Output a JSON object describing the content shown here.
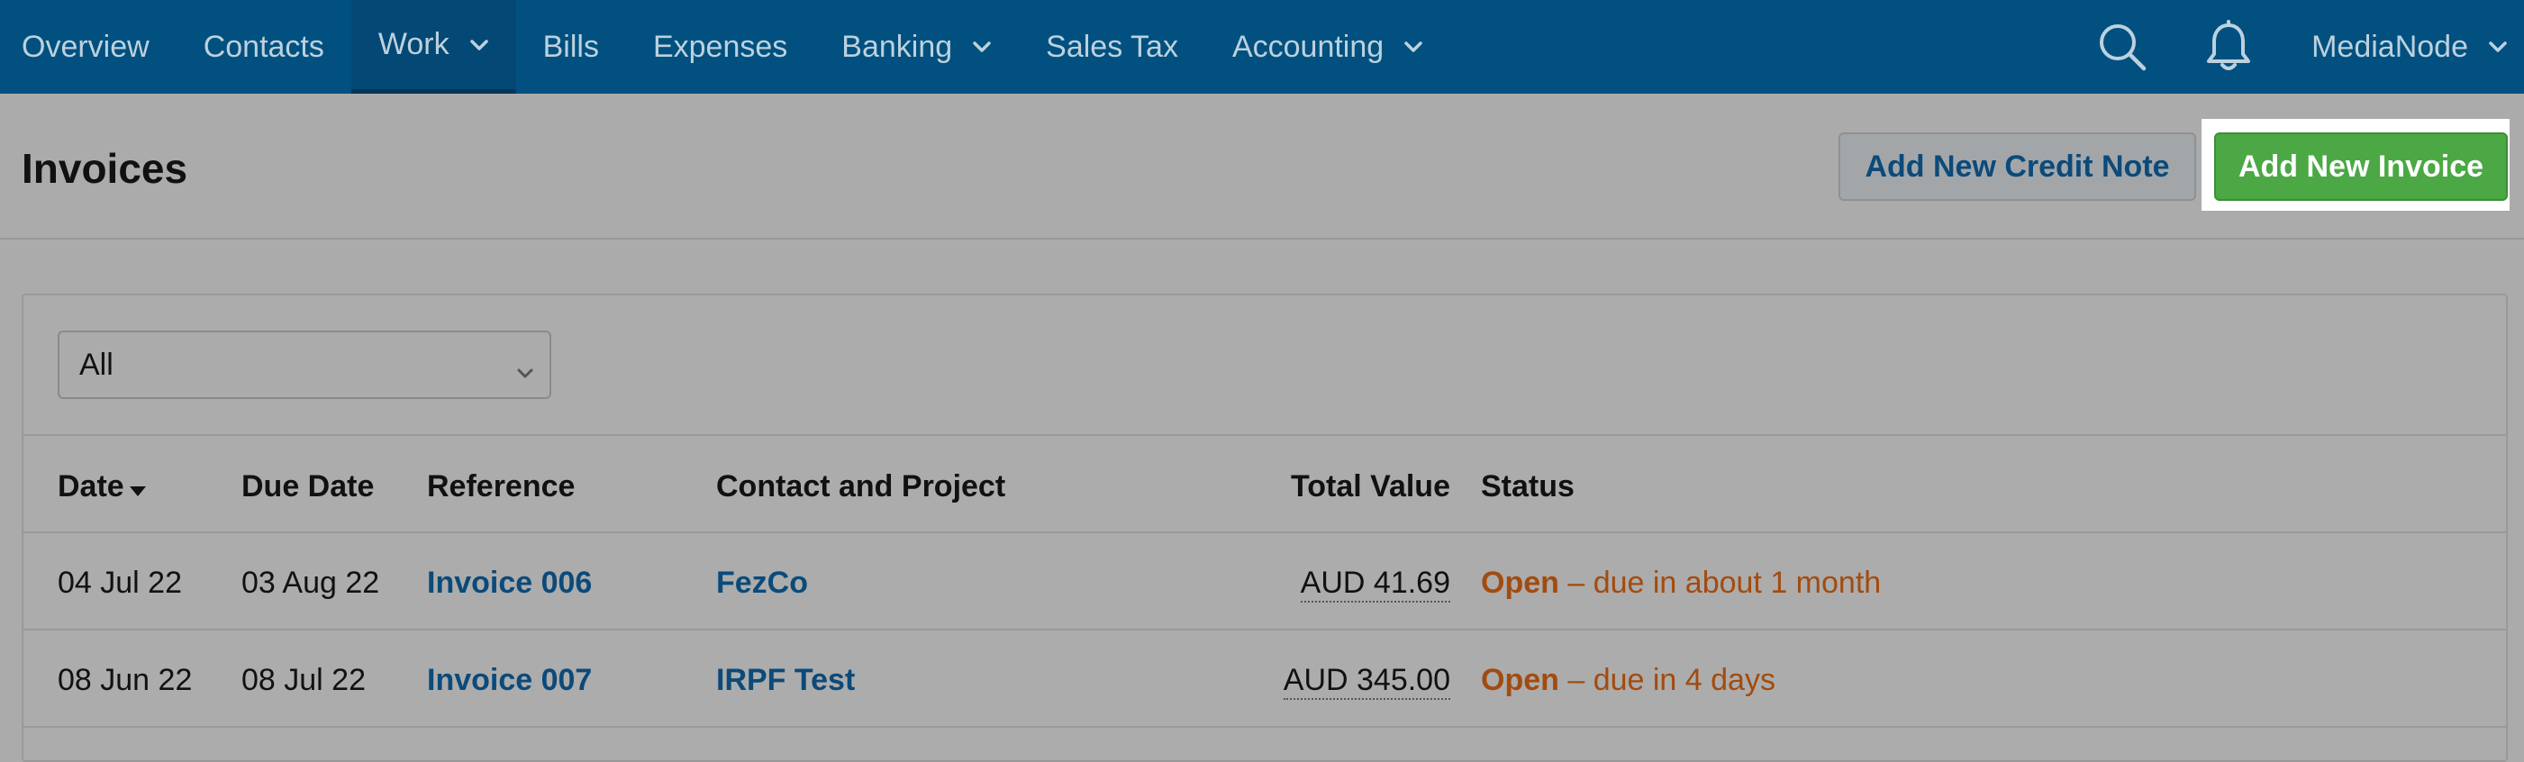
{
  "nav": {
    "items": [
      {
        "label": "Overview",
        "dropdown": false,
        "active": false
      },
      {
        "label": "Contacts",
        "dropdown": false,
        "active": false
      },
      {
        "label": "Work",
        "dropdown": true,
        "active": true
      },
      {
        "label": "Bills",
        "dropdown": false,
        "active": false
      },
      {
        "label": "Expenses",
        "dropdown": false,
        "active": false
      },
      {
        "label": "Banking",
        "dropdown": true,
        "active": false
      },
      {
        "label": "Sales Tax",
        "dropdown": false,
        "active": false
      },
      {
        "label": "Accounting",
        "dropdown": true,
        "active": false
      }
    ],
    "user": "MediaNode",
    "icons": [
      "search-icon",
      "bell-icon",
      "chevron-down-icon"
    ]
  },
  "header": {
    "title": "Invoices",
    "credit_button": "Add New Credit Note",
    "invoice_button": "Add New Invoice"
  },
  "filter": {
    "selected": "All"
  },
  "table": {
    "columns": {
      "date": "Date",
      "due_date": "Due Date",
      "reference": "Reference",
      "contact": "Contact and Project",
      "total": "Total Value",
      "status": "Status"
    },
    "rows": [
      {
        "date": "04 Jul 22",
        "due_date": "03 Aug 22",
        "reference": "Invoice 006",
        "contact": "FezCo",
        "total": "AUD 41.69",
        "status": "Open",
        "status_detail": " – due in about 1 month"
      },
      {
        "date": "08 Jun 22",
        "due_date": "08 Jul 22",
        "reference": "Invoice 007",
        "contact": "IRPF Test",
        "total": "AUD 345.00",
        "status": "Open",
        "status_detail": " – due in 4 days"
      }
    ]
  },
  "colors": {
    "nav_bg": "#01507f",
    "primary_button": "#4ba844",
    "link": "#0b4a7a",
    "status_open": "#a34b0f"
  }
}
